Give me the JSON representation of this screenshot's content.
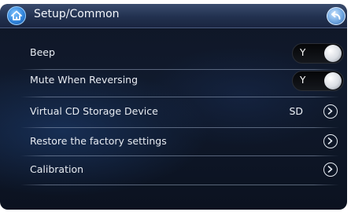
{
  "header": {
    "title": "Setup/Common"
  },
  "settings": [
    {
      "label": "Beep",
      "control": "toggle",
      "value": "Y"
    },
    {
      "label": "Mute When Reversing",
      "control": "toggle",
      "value": "Y"
    },
    {
      "label": "Virtual CD Storage Device",
      "control": "chevron",
      "value": "SD"
    },
    {
      "label": "Restore the factory settings",
      "control": "chevron"
    },
    {
      "label": "Calibration",
      "control": "chevron"
    }
  ],
  "icons": {
    "home": "home-icon",
    "back": "back-arrow-icon",
    "chevron": "chevron-right-circle-icon"
  },
  "colors": {
    "background": "#101a2d",
    "header": "#22314f",
    "accent_blue": "#2c7fd6",
    "text": "#e8ecf2"
  }
}
